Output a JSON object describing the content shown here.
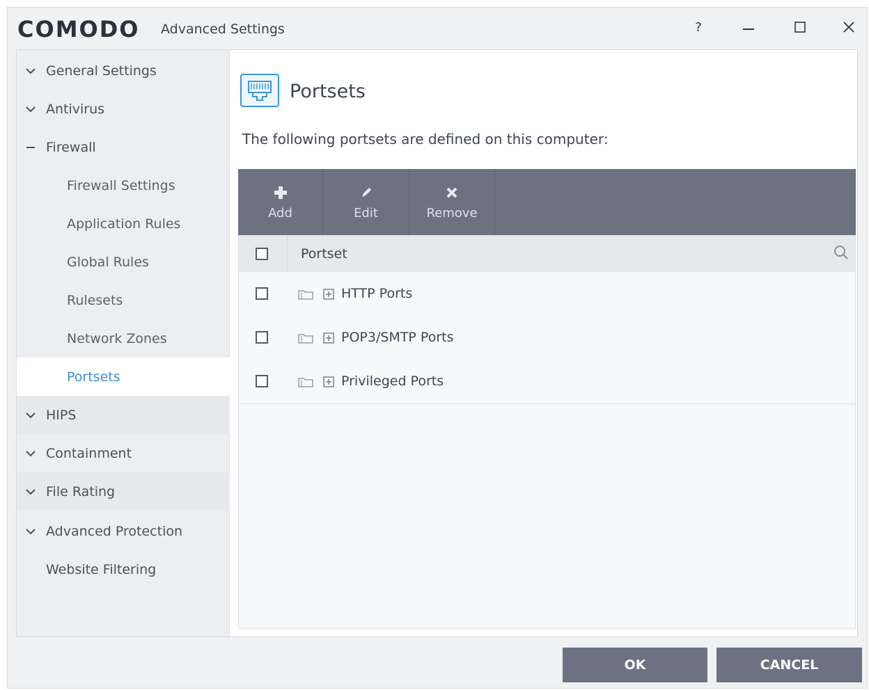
{
  "window": {
    "logo": "COMODO",
    "title": "Advanced Settings",
    "controls": {
      "help": "?",
      "minimize_icon": "minimize-icon",
      "maximize_icon": "maximize-icon",
      "close_icon": "close-icon"
    }
  },
  "sidebar": {
    "items": [
      {
        "label": "General Settings",
        "state": "collapsed"
      },
      {
        "label": "Antivirus",
        "state": "collapsed"
      },
      {
        "label": "Firewall",
        "state": "expanded"
      },
      {
        "label": "Firewall Settings",
        "sub": true
      },
      {
        "label": "Application Rules",
        "sub": true
      },
      {
        "label": "Global Rules",
        "sub": true
      },
      {
        "label": "Rulesets",
        "sub": true
      },
      {
        "label": "Network Zones",
        "sub": true
      },
      {
        "label": "Portsets",
        "sub": true,
        "active": true
      },
      {
        "label": "HIPS",
        "state": "collapsed"
      },
      {
        "label": "Containment",
        "state": "collapsed"
      },
      {
        "label": "File Rating",
        "state": "collapsed"
      },
      {
        "label": "Advanced Protection",
        "state": "collapsed"
      },
      {
        "label": "Website Filtering"
      }
    ]
  },
  "main": {
    "title": "Portsets",
    "description": "The following portsets are defined on this computer:",
    "toolbar": {
      "add": "Add",
      "edit": "Edit",
      "remove": "Remove"
    },
    "table": {
      "column": "Portset",
      "rows": [
        {
          "name": "HTTP Ports"
        },
        {
          "name": "POP3/SMTP Ports"
        },
        {
          "name": "Privileged Ports"
        }
      ]
    }
  },
  "footer": {
    "ok": "OK",
    "cancel": "CANCEL"
  },
  "colors": {
    "accent": "#3e8fd4",
    "toolbar": "#6d7282",
    "button": "#6d7282"
  }
}
